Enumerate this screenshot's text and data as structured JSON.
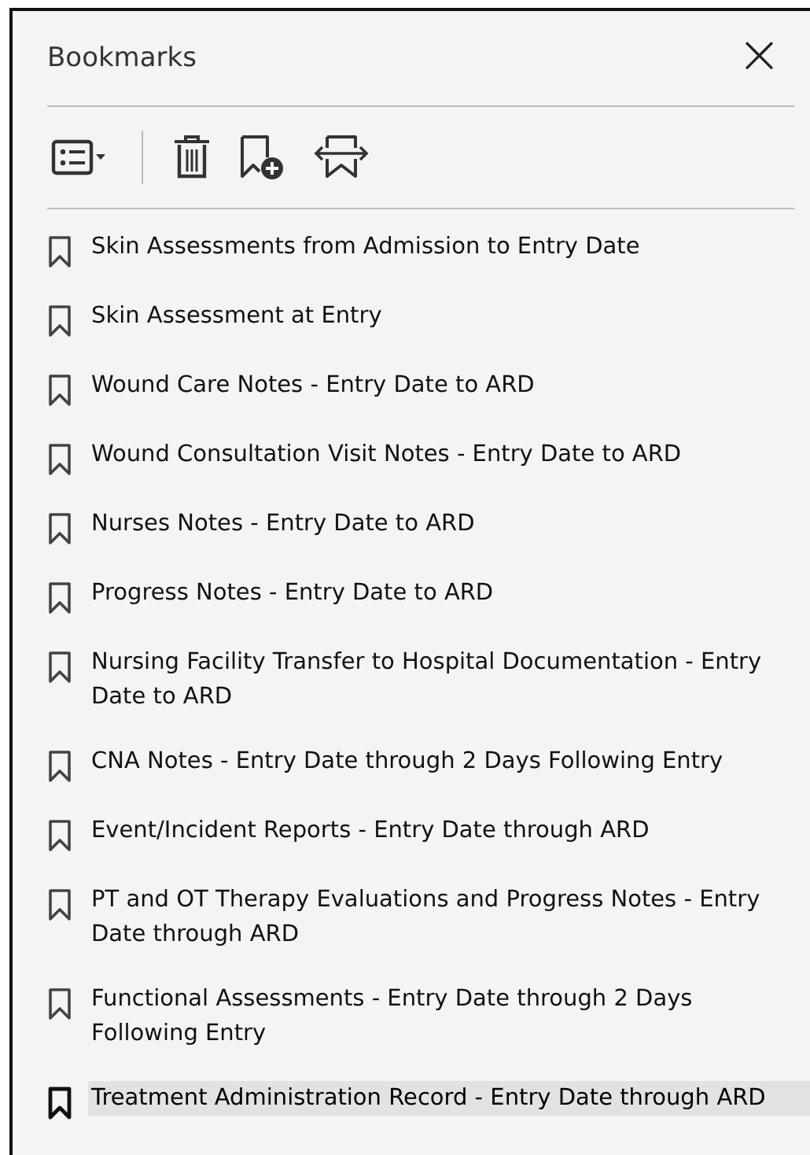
{
  "panel": {
    "title": "Bookmarks",
    "close": "×"
  },
  "bookmarks": [
    {
      "label": "Skin Assessments from Admission to Entry Date",
      "selected": false
    },
    {
      "label": "Skin Assessment at Entry",
      "selected": false
    },
    {
      "label": "Wound Care Notes - Entry Date to ARD",
      "selected": false
    },
    {
      "label": "Wound Consultation Visit Notes - Entry Date to ARD",
      "selected": false
    },
    {
      "label": "Nurses Notes - Entry Date to ARD",
      "selected": false
    },
    {
      "label": "Progress Notes - Entry Date to ARD",
      "selected": false
    },
    {
      "label": "Nursing Facility Transfer to Hospital Documentation - Entry Date to ARD",
      "selected": false
    },
    {
      "label": "CNA Notes - Entry Date through 2 Days Following Entry",
      "selected": false
    },
    {
      "label": "Event/Incident Reports - Entry Date through ARD",
      "selected": false
    },
    {
      "label": "PT and OT Therapy Evaluations and Progress Notes - Entry Date through ARD",
      "selected": false
    },
    {
      "label": "Functional Assessments - Entry Date through 2 Days Following Entry",
      "selected": false
    },
    {
      "label": "Treatment Administration Record - Entry Date through ARD",
      "selected": true
    }
  ]
}
